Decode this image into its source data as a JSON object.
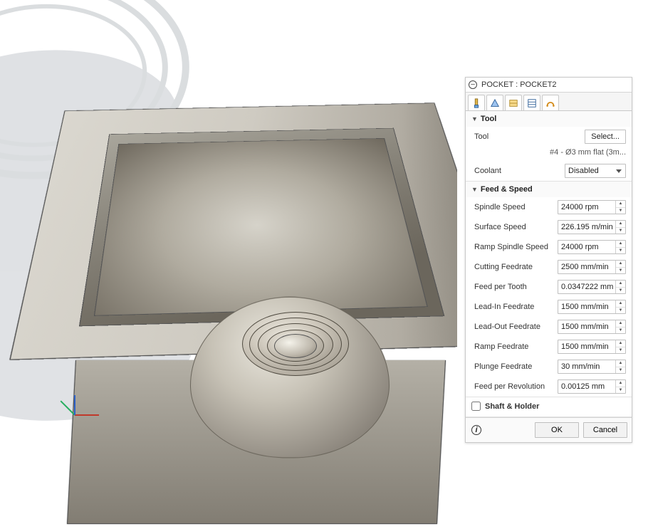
{
  "panel": {
    "title": "POCKET : POCKET2",
    "tabs_count": 5
  },
  "tool_section": {
    "heading": "Tool",
    "tool_label": "Tool",
    "select_button": "Select...",
    "tool_description": "#4 - Ø3 mm flat (3m...",
    "coolant_label": "Coolant",
    "coolant_value": "Disabled"
  },
  "feed_section": {
    "heading": "Feed & Speed",
    "rows": [
      {
        "label": "Spindle Speed",
        "value": "24000 rpm"
      },
      {
        "label": "Surface Speed",
        "value": "226.195 m/min"
      },
      {
        "label": "Ramp Spindle Speed",
        "value": "24000 rpm"
      },
      {
        "label": "Cutting Feedrate",
        "value": "2500 mm/min"
      },
      {
        "label": "Feed per Tooth",
        "value": "0.0347222 mm"
      },
      {
        "label": "Lead-In Feedrate",
        "value": "1500 mm/min"
      },
      {
        "label": "Lead-Out Feedrate",
        "value": "1500 mm/min"
      },
      {
        "label": "Ramp Feedrate",
        "value": "1500 mm/min"
      },
      {
        "label": "Plunge Feedrate",
        "value": "30 mm/min"
      },
      {
        "label": "Feed per Revolution",
        "value": "0.00125 mm"
      }
    ]
  },
  "shaft_section": {
    "label": "Shaft & Holder",
    "checked": false
  },
  "footer": {
    "ok": "OK",
    "cancel": "Cancel"
  }
}
